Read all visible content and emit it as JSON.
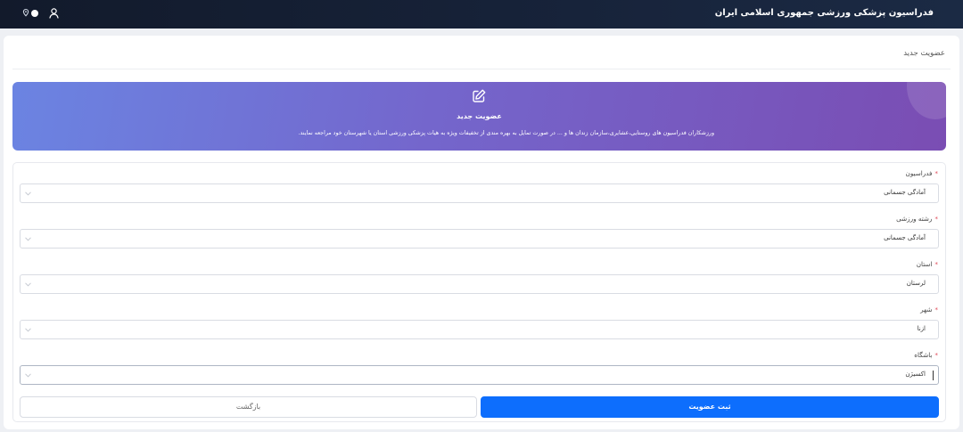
{
  "header": {
    "brand": "فدراسیون پزشکی ورزشی جمهوری اسلامی ایران",
    "background": "#121a2b",
    "icons": [
      "user-icon",
      "theme-toggle-icon",
      "location-pin-icon"
    ]
  },
  "page": {
    "title": "عضویت جدید"
  },
  "banner": {
    "icon": "edit-icon",
    "title": "عضویت جدید",
    "description": "ورزشکاران فدراسیون های روستایی،عشایری،سازمان زندان ها و ... در صورت تمایل به بهره مندی از تخفیفات ویژه به هیات پزشکی ورزشی استان یا شهرستان خود مراجعه نمایند.",
    "gradient": [
      "#6b84e2",
      "#7a4db3"
    ]
  },
  "form": {
    "required_mark": "*",
    "fields": [
      {
        "label": "فدراسیون",
        "value": "آمادگی جسمانی"
      },
      {
        "label": "رشته ورزشی",
        "value": "آمادگی جسمانی"
      },
      {
        "label": "استان",
        "value": "لرستان"
      },
      {
        "label": "شهر",
        "value": "ازنا"
      },
      {
        "label": "باشگاه",
        "value": "اکسیژن"
      }
    ],
    "submit_label": "ثبت عضویت",
    "back_label": "بازگشت",
    "accent": "#0d6efd",
    "required_color": "#e04b5a"
  }
}
